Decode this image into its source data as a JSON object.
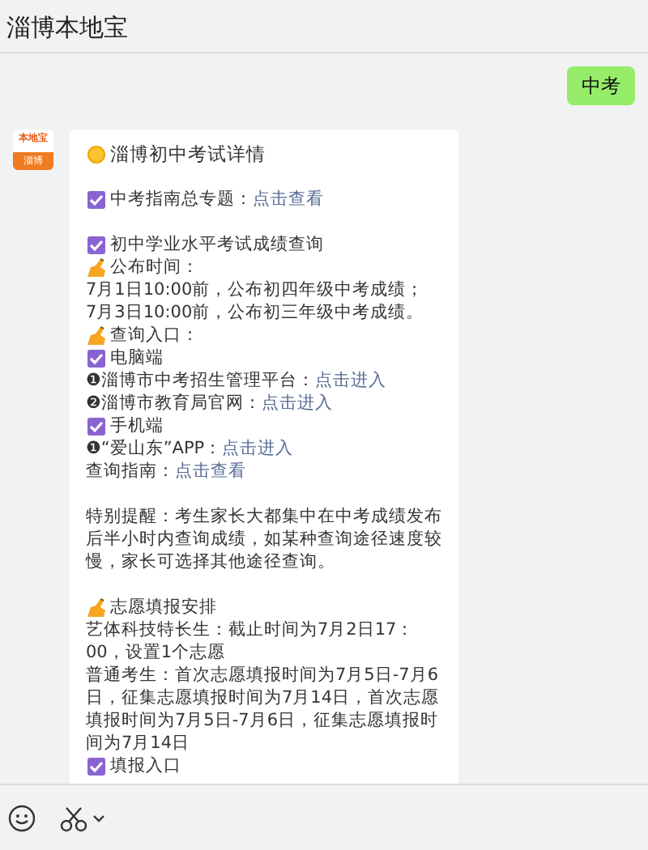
{
  "window": {
    "title": "淄博本地宝"
  },
  "messages": [
    {
      "kind": "sent",
      "text": "中考"
    },
    {
      "kind": "article",
      "avatar": {
        "line_1": "本地宝",
        "line_2": "淄博"
      },
      "lines": [
        {
          "kind": "heading",
          "text": "淄博初中考试详情"
        },
        {
          "kind": "blank"
        },
        {
          "kind": "check",
          "text": "中考指南总专题：",
          "link": "点击查看"
        },
        {
          "kind": "blank"
        },
        {
          "kind": "check",
          "text": "初中学业水平考试成绩查询"
        },
        {
          "kind": "hand",
          "text": "公布时间："
        },
        {
          "kind": "plain",
          "text": "7月1日10:00前，公布初四年级中考成绩；"
        },
        {
          "kind": "plain",
          "text": "7月3日10:00前，公布初三年级中考成绩。"
        },
        {
          "kind": "hand",
          "text": "查询入口："
        },
        {
          "kind": "check",
          "text": "电脑端"
        },
        {
          "kind": "plain",
          "text": "❶淄博市中考招生管理平台：",
          "link": "点击进入"
        },
        {
          "kind": "plain",
          "text": "❷淄博市教育局官网：",
          "link": "点击进入"
        },
        {
          "kind": "check",
          "text": "手机端"
        },
        {
          "kind": "plain",
          "text": "❶“爱山东”APP：",
          "link": "点击进入"
        },
        {
          "kind": "plain",
          "text": "查询指南：",
          "link": "点击查看"
        },
        {
          "kind": "blank"
        },
        {
          "kind": "plain",
          "text": "特别提醒：考生家长大都集中在中考成绩发布后半小时内查询成绩，如某种查询途径速度较慢，家长可选择其他途径查询。"
        },
        {
          "kind": "blank"
        },
        {
          "kind": "hand",
          "text": "志愿填报安排"
        },
        {
          "kind": "plain",
          "text": "艺体科技特长生：截止时间为7月2日17：00，设置1个志愿"
        },
        {
          "kind": "plain",
          "text": "普通考生：首次志愿填报时间为7月5日-7月6日，征集志愿填报时间为7月14日，首次志愿填报时间为7月5日-7月6日，征集志愿填报时间为7月14日"
        },
        {
          "kind": "check",
          "text": "填报入口"
        }
      ]
    }
  ]
}
